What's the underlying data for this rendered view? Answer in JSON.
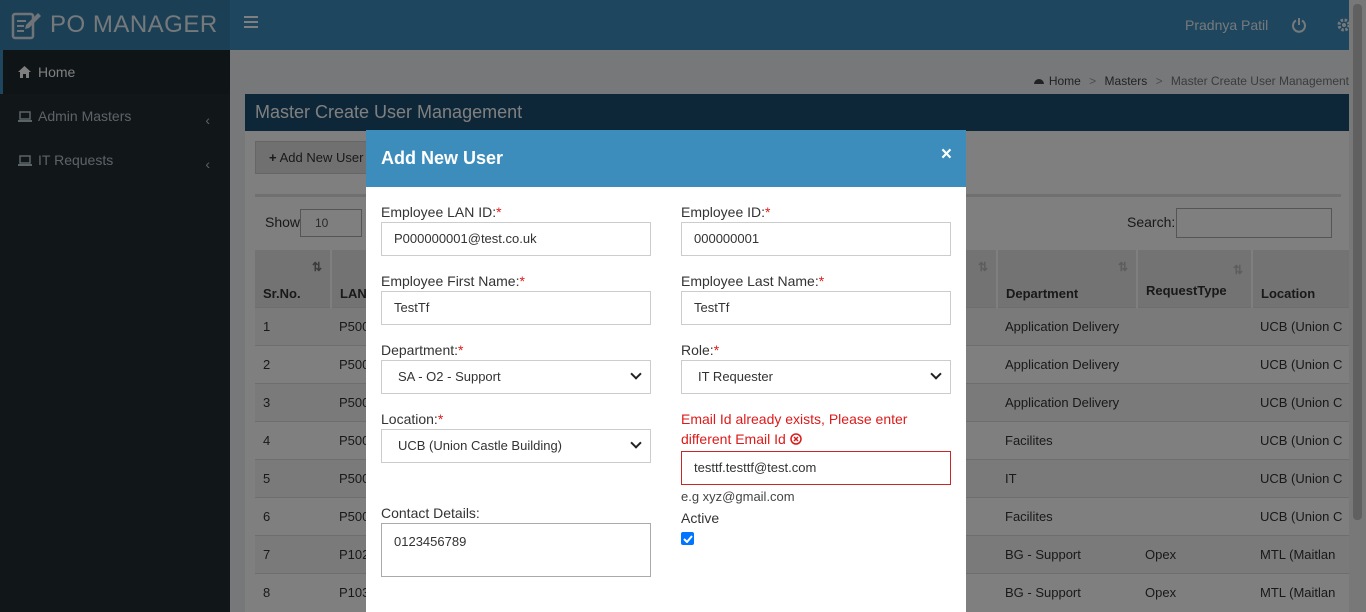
{
  "app": {
    "title": "PO MANAGER",
    "user_name": "Pradnya Patil"
  },
  "sidebar": {
    "items": [
      {
        "label": "Home",
        "icon": "home-icon",
        "active": true
      },
      {
        "label": "Admin Masters",
        "icon": "laptop-icon"
      },
      {
        "label": "IT Requests",
        "icon": "laptop-icon"
      }
    ]
  },
  "breadcrumb": {
    "home": "Home",
    "masters": "Masters",
    "current": "Master Create User Management"
  },
  "page": {
    "title": "Master Create User Management",
    "add_button": "Add New User",
    "show_label": "Show",
    "show_value": "10",
    "search_label": "Search:"
  },
  "table": {
    "headers": [
      "Sr.No.",
      "LAN",
      "Department",
      "RequestType",
      "Location"
    ],
    "rows": [
      {
        "sr": "1",
        "lan": "P500",
        "dept": "Application Delivery",
        "req": "",
        "loc": "UCB (Union C"
      },
      {
        "sr": "2",
        "lan": "P500",
        "dept": "Application Delivery",
        "req": "",
        "loc": "UCB (Union C"
      },
      {
        "sr": "3",
        "lan": "P500",
        "dept": "Application Delivery",
        "req": "",
        "loc": "UCB (Union C"
      },
      {
        "sr": "4",
        "lan": "P500",
        "dept": "Facilites",
        "req": "",
        "loc": "UCB (Union C"
      },
      {
        "sr": "5",
        "lan": "P500",
        "dept": "IT",
        "req": "",
        "loc": "UCB (Union C"
      },
      {
        "sr": "6",
        "lan": "P500",
        "dept": "Facilites",
        "req": "",
        "loc": "UCB (Union C"
      },
      {
        "sr": "7",
        "lan": "P102",
        "dept": "BG - Support",
        "req": "Opex",
        "loc": "MTL (Maitlan"
      },
      {
        "sr": "8",
        "lan": "P103",
        "dept": "BG - Support",
        "req": "Opex",
        "loc": "MTL (Maitlan"
      }
    ]
  },
  "modal": {
    "title": "Add New User",
    "close": "×",
    "lan_id_label": "Employee LAN ID:",
    "lan_id_value": "P000000001@test.co.uk",
    "emp_id_label": "Employee ID:",
    "emp_id_value": "000000001",
    "first_name_label": "Employee First Name:",
    "first_name_value": "TestTf",
    "last_name_label": "Employee Last Name:",
    "last_name_value": "TestTf",
    "department_label": "Department:",
    "department_value": "SA - O2 - Support",
    "role_label": "Role:",
    "role_value": "IT Requester",
    "location_label": "Location:",
    "location_value": "UCB (Union Castle Building)",
    "email_error": "Email Id already exists, Please enter different Email Id",
    "email_value": "testtf.testtf@test.com",
    "email_hint": "e.g xyz@gmail.com",
    "contact_label": "Contact Details:",
    "contact_value": "0123456789",
    "active_label": "Active",
    "required_mark": "*"
  },
  "colors": {
    "header": "#3c8dbc",
    "sidebar": "#222d32",
    "panel_head": "#1b4f72",
    "error": "#dd1a1a"
  }
}
